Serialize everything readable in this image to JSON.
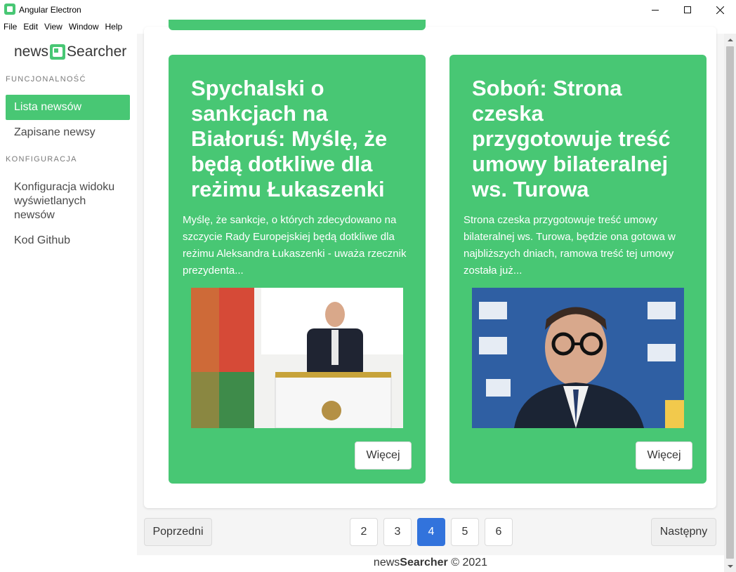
{
  "window": {
    "title": "Angular Electron",
    "minimize_icon": "minimize-icon",
    "maximize_icon": "maximize-icon",
    "close_icon": "close-icon"
  },
  "menubar": {
    "items": [
      "File",
      "Edit",
      "View",
      "Window",
      "Help"
    ]
  },
  "sidebar": {
    "logo_left": "news",
    "logo_right": "Searcher",
    "section_functions": "FUNCJONALNOŚĆ",
    "items_functions": [
      "Lista newsów",
      "Zapisane newsy"
    ],
    "section_config": "KONFIGURACJA",
    "items_config": [
      "Konfiguracja widoku wyświetlanych newsów",
      "Kod Github"
    ]
  },
  "cards": [
    {
      "title": "Spychalski o sankcjach na Białoruś: Myślę, że będą dotkliwe dla reżimu Łukaszenki",
      "description": "Myślę, że sankcje, o których zdecydowano na szczycie Rady Europejskiej będą dotkliwe dla reżimu Aleksandra Łukaszenki - uważa rzecznik prezydenta...",
      "button": "Więcej"
    },
    {
      "title": "Soboń: Strona czeska przygotowuje treść umowy bilateralnej ws. Turowa",
      "description": "Strona czeska przygotowuje treść umowy bilateralnej ws. Turowa, będzie ona gotowa w najbliższych dniach, ramowa treść tej umowy została już...",
      "button": "Więcej"
    }
  ],
  "pagination": {
    "prev": "Poprzedni",
    "next": "Następny",
    "pages": [
      "2",
      "3",
      "4",
      "5",
      "6"
    ],
    "current": "4"
  },
  "footer": {
    "brand_left": "news",
    "brand_right": "Searcher",
    "copyright": "© 2021"
  },
  "colors": {
    "accent_green": "#48c774",
    "pagination_current": "#3273dc"
  }
}
